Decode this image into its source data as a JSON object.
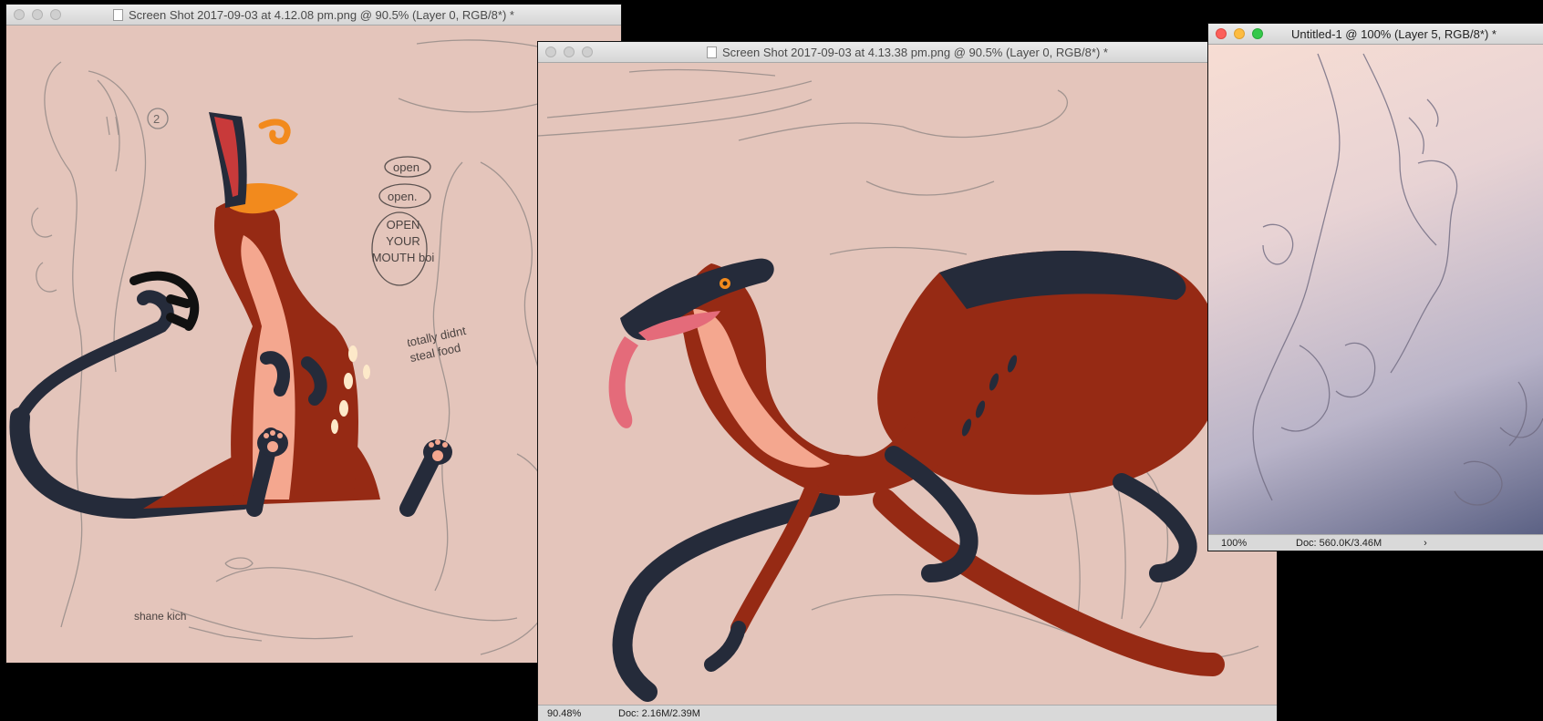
{
  "windows": [
    {
      "id": "sheet",
      "title": "Screen Shot 2017-09-03 at 4.12.08 pm.png @ 90.5% (Layer 0, RGB/8*) *",
      "sketch_notes": [
        "open",
        "open.",
        "OPEN YOUR MOUTH boi",
        "totally didnt steal food",
        "shane kich",
        "2"
      ]
    },
    {
      "id": "main",
      "title": "Screen Shot 2017-09-03 at 4.13.38 pm.png @ 90.5% (Layer 0, RGB/8*) *",
      "status": {
        "zoom": "90.48%",
        "doc": "Doc: 2.16M/2.39M"
      }
    },
    {
      "id": "untitled",
      "title": "Untitled-1 @ 100% (Layer 5, RGB/8*) *",
      "status": {
        "zoom": "100%",
        "doc": "Doc: 560.0K/3.46M",
        "arrow": "›"
      }
    }
  ],
  "colors": {
    "canvas_bg": "#e4c5bb",
    "body_red": "#962a14",
    "dark_navy": "#252b3a",
    "belly_peach": "#f4a78f",
    "mouth_pink": "#e46b7a",
    "accent_orange": "#f28a1d",
    "sketch_grey": "#8c8482"
  },
  "icons": [
    "document-icon",
    "close-light-icon",
    "minimize-light-icon",
    "zoom-light-icon",
    "disclosure-arrow-icon"
  ]
}
